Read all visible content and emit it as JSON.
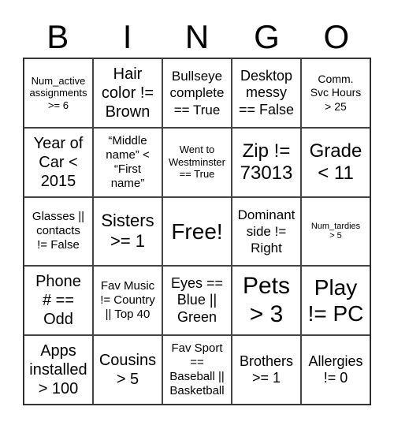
{
  "header": {
    "letters": [
      "B",
      "I",
      "N",
      "G",
      "O"
    ]
  },
  "cells": [
    "Num_active\nassignments\n>= 6",
    "Hair\ncolor !=\nBrown",
    "Bullseye\ncomplete\n== True",
    "Desktop\nmessy\n== False",
    "Comm.\nSvc Hours\n> 25",
    "Year of\nCar <\n2015",
    "“Middle\nname” <\n“First\nname”",
    "Went to\nWestminster\n== True",
    "Zip !=\n73013",
    "Grade\n< 11",
    "Glasses ||\ncontacts\n!= False",
    "Sisters\n>= 1",
    "Free!",
    "Dominant\nside !=\nRight",
    "Num_tardies\n> 5",
    "Phone\n# ==\nOdd",
    "Fav Music\n!= Country\n|| Top 40",
    "Eyes ==\nBlue ||\nGreen",
    "Pets\n> 3",
    "Play\n!= PC",
    "Apps\ninstalled\n> 100",
    "Cousins\n> 5",
    "Fav Sport\n==\nBaseball ||\nBasketball",
    "Brothers\n>= 1",
    "Allergies\n!= 0"
  ]
}
